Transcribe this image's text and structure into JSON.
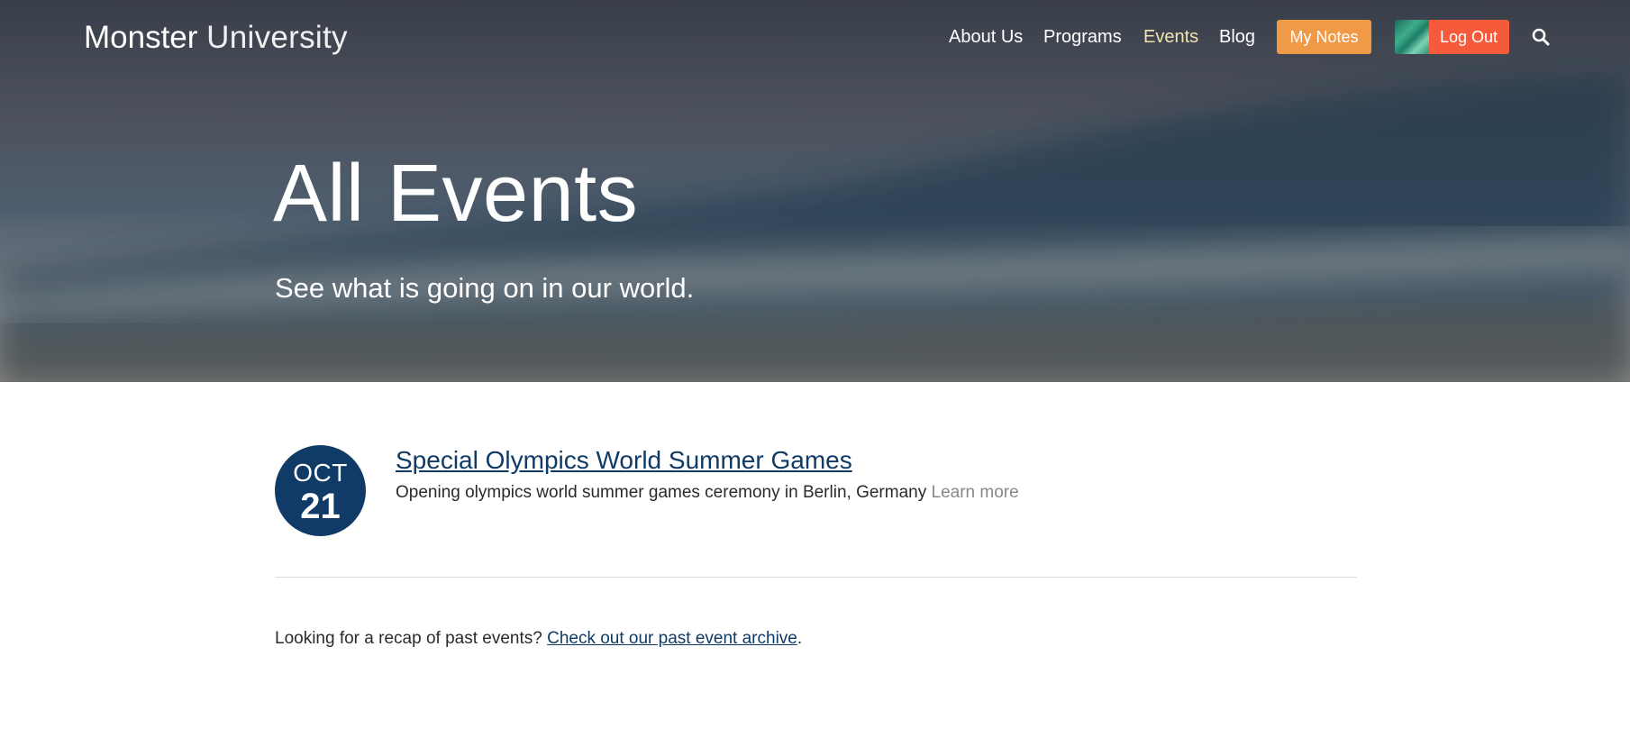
{
  "brand": {
    "name_strong": "Monster",
    "name_light": "University"
  },
  "nav": {
    "items": [
      {
        "label": "About Us"
      },
      {
        "label": "Programs"
      },
      {
        "label": "Events",
        "active": true
      },
      {
        "label": "Blog"
      }
    ],
    "my_notes_label": "My Notes",
    "logout_label": "Log Out",
    "search_icon": "search-icon"
  },
  "hero": {
    "title": "All Events",
    "subtitle": "See what is going on in our world."
  },
  "events": [
    {
      "month": "OCT",
      "day": "21",
      "title": "Special Olympics World Summer Games",
      "description": "Opening olympics world summer games ceremony in Berlin, Germany",
      "learn_more": "Learn more"
    }
  ],
  "archive": {
    "prefix": "Looking for a recap of past events?",
    "link_text": "Check out our past event archive",
    "suffix": "."
  },
  "colors": {
    "accent_dark_blue": "#0f3b66",
    "my_notes_orange": "#f09a48",
    "logout_red": "#f55b3a",
    "active_nav": "#f2e3b3"
  }
}
